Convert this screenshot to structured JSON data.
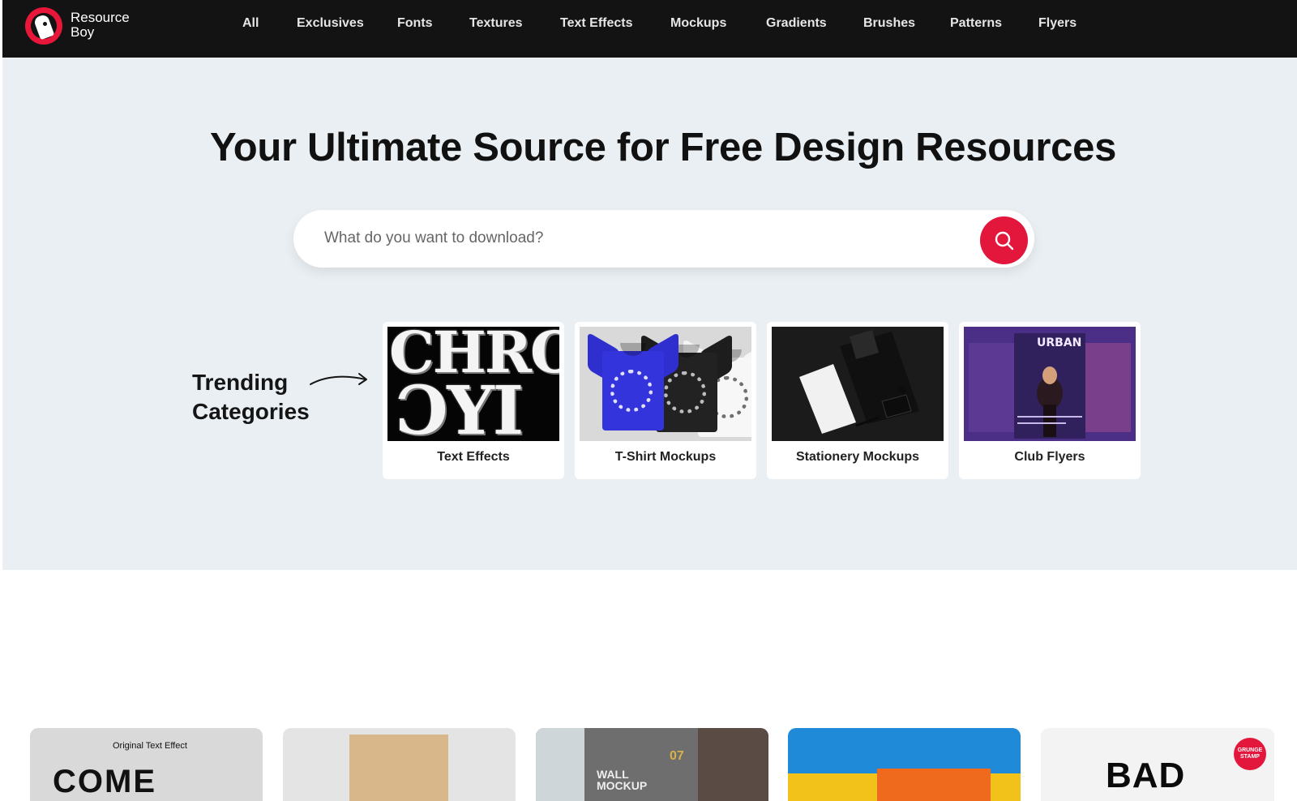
{
  "brand": {
    "name_line1": "Resource",
    "name_line2": "Boy"
  },
  "nav": [
    "All",
    "Exclusives",
    "Fonts",
    "Textures",
    "Text Effects",
    "Mockups",
    "Gradients",
    "Brushes",
    "Patterns",
    "Flyers"
  ],
  "hero": {
    "title": "Your Ultimate Source for Free Design Resources",
    "search_placeholder": "What do you want to download?"
  },
  "trending": {
    "line1": "Trending",
    "line2": "Categories",
    "cards": [
      {
        "label": "Text Effects",
        "image_text_1": "CHRO",
        "image_text_2": "ƆYI"
      },
      {
        "label": "T-Shirt Mockups"
      },
      {
        "label": "Stationery Mockups"
      },
      {
        "label": "Club Flyers",
        "image_text": "URBAN"
      }
    ]
  },
  "thumbs": [
    {
      "caption": "Original Text Effect",
      "text": "COME BACK"
    },
    {
      "caption": ""
    },
    {
      "caption": "WALL MOCKUP",
      "num": "07"
    },
    {
      "caption": ""
    },
    {
      "caption": "BAD",
      "badge": "GRUNGE STAMP"
    }
  ],
  "colors": {
    "accent": "#e3163c",
    "topbar": "#131313",
    "hero_bg": "#e9eff2"
  }
}
